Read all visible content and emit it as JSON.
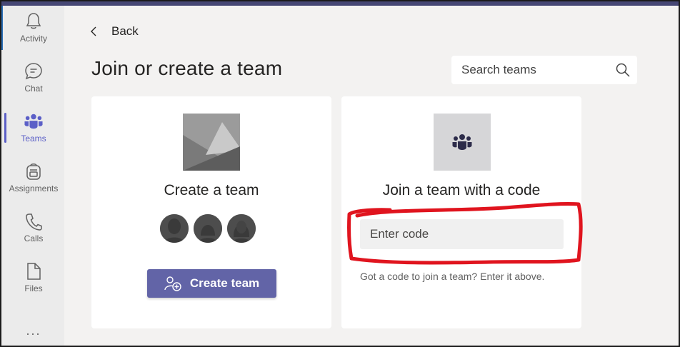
{
  "colors": {
    "accent": "#6264a7",
    "rail_active": "#5b5fc7",
    "annotation": "#e0141e"
  },
  "rail": {
    "items": [
      {
        "label": "Activity",
        "icon": "bell-icon"
      },
      {
        "label": "Chat",
        "icon": "chat-icon"
      },
      {
        "label": "Teams",
        "icon": "teams-icon"
      },
      {
        "label": "Assignments",
        "icon": "backpack-icon"
      },
      {
        "label": "Calls",
        "icon": "phone-icon"
      },
      {
        "label": "Files",
        "icon": "file-icon"
      }
    ],
    "more": "..."
  },
  "header": {
    "back_label": "Back",
    "title": "Join or create a team",
    "search_placeholder": "Search teams"
  },
  "create_card": {
    "title": "Create a team",
    "button_label": "Create team"
  },
  "join_card": {
    "title": "Join a team with a code",
    "code_placeholder": "Enter code",
    "hint": "Got a code to join a team? Enter it above."
  }
}
